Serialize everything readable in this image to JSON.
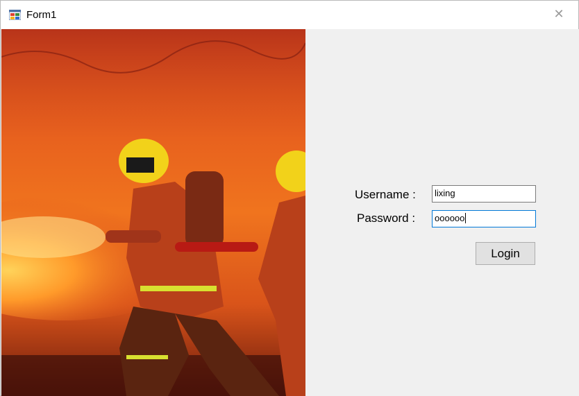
{
  "window": {
    "title": "Form1",
    "close_glyph": "✕"
  },
  "image_panel": {
    "description_icon": "firefighters-photo"
  },
  "form": {
    "username_label": "Username :",
    "password_label": "Password :",
    "username_value": "lixing",
    "password_value": "oooooo",
    "login_label": "Login"
  },
  "colors": {
    "window_bg": "#f0f0f0",
    "focus_border": "#0078d7",
    "button_bg": "#e1e1e1"
  }
}
